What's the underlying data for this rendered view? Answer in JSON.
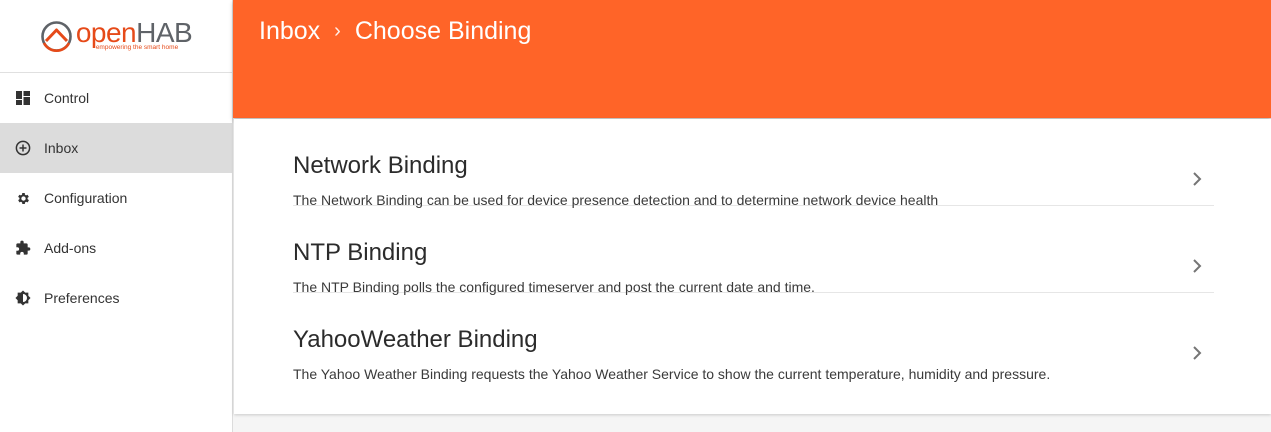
{
  "brand": {
    "logo_open": "open",
    "logo_hab": "HAB",
    "tagline": "empowering the smart home"
  },
  "sidebar": {
    "items": [
      {
        "label": "Control",
        "icon": "dashboard-icon",
        "active": false
      },
      {
        "label": "Inbox",
        "icon": "add-circle-icon",
        "active": true
      },
      {
        "label": "Configuration",
        "icon": "gear-icon",
        "active": false
      },
      {
        "label": "Add-ons",
        "icon": "puzzle-icon",
        "active": false
      },
      {
        "label": "Preferences",
        "icon": "brightness-icon",
        "active": false
      }
    ]
  },
  "header": {
    "breadcrumb": [
      "Inbox",
      "Choose Binding"
    ],
    "separator": "›",
    "color": "#ff6428"
  },
  "bindings": [
    {
      "title": "Network Binding",
      "description": "The Network Binding can be used for device presence detection and to determine network device health"
    },
    {
      "title": "NTP Binding",
      "description": "The NTP Binding polls the configured timeserver and post the current date and time."
    },
    {
      "title": "YahooWeather Binding",
      "description": "The Yahoo Weather Binding requests the Yahoo Weather Service to show the current temperature, humidity and pressure."
    }
  ]
}
